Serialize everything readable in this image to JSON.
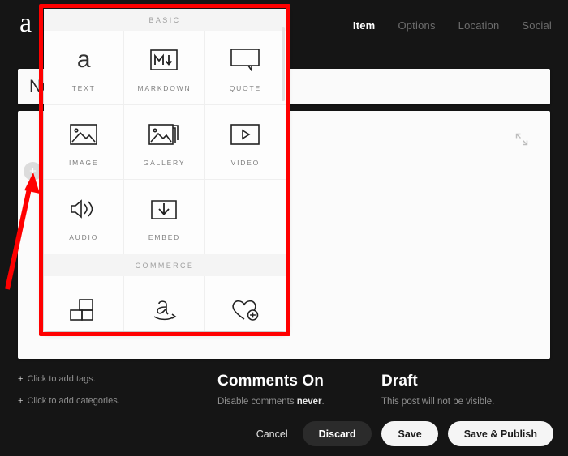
{
  "app": {
    "logo_glyph": "a",
    "logo_name": "brand-logo"
  },
  "nav": {
    "tabs": [
      {
        "label": "Item",
        "active": true
      },
      {
        "label": "Options",
        "active": false
      },
      {
        "label": "Location",
        "active": false
      },
      {
        "label": "Social",
        "active": false
      }
    ]
  },
  "editor": {
    "title_placeholder": "New Post",
    "title_value": "",
    "add_block_label": "+",
    "expand_icon": "expand-diagonal-icon"
  },
  "picker": {
    "sections": [
      {
        "heading": "BASIC",
        "items": [
          {
            "label": "TEXT",
            "icon": "text-a-icon"
          },
          {
            "label": "MARKDOWN",
            "icon": "markdown-icon"
          },
          {
            "label": "QUOTE",
            "icon": "quote-bubble-icon"
          },
          {
            "label": "IMAGE",
            "icon": "image-icon"
          },
          {
            "label": "GALLERY",
            "icon": "gallery-icon"
          },
          {
            "label": "VIDEO",
            "icon": "video-play-icon"
          },
          {
            "label": "AUDIO",
            "icon": "audio-speaker-icon"
          },
          {
            "label": "EMBED",
            "icon": "embed-download-icon"
          },
          {
            "label": "",
            "icon": ""
          }
        ]
      },
      {
        "heading": "COMMERCE",
        "items": [
          {
            "label": "",
            "icon": "product-blocks-icon"
          },
          {
            "label": "",
            "icon": "amazon-icon"
          },
          {
            "label": "",
            "icon": "wishlist-heart-icon"
          }
        ]
      }
    ]
  },
  "meta": {
    "tags_label": "Click to add tags.",
    "categories_label": "Click to add categories.",
    "plus_glyph": "+",
    "comments": {
      "title": "Comments On",
      "sub_prefix": "Disable comments ",
      "sub_emphasis": "never",
      "sub_suffix": "."
    },
    "status": {
      "title": "Draft",
      "sub": "This post will not be visible."
    }
  },
  "actions": {
    "cancel": "Cancel",
    "discard": "Discard",
    "save": "Save",
    "save_publish": "Save & Publish"
  },
  "annotation": {
    "color": "#ff0000",
    "shape": "arrow-pointing-to-add-button"
  }
}
